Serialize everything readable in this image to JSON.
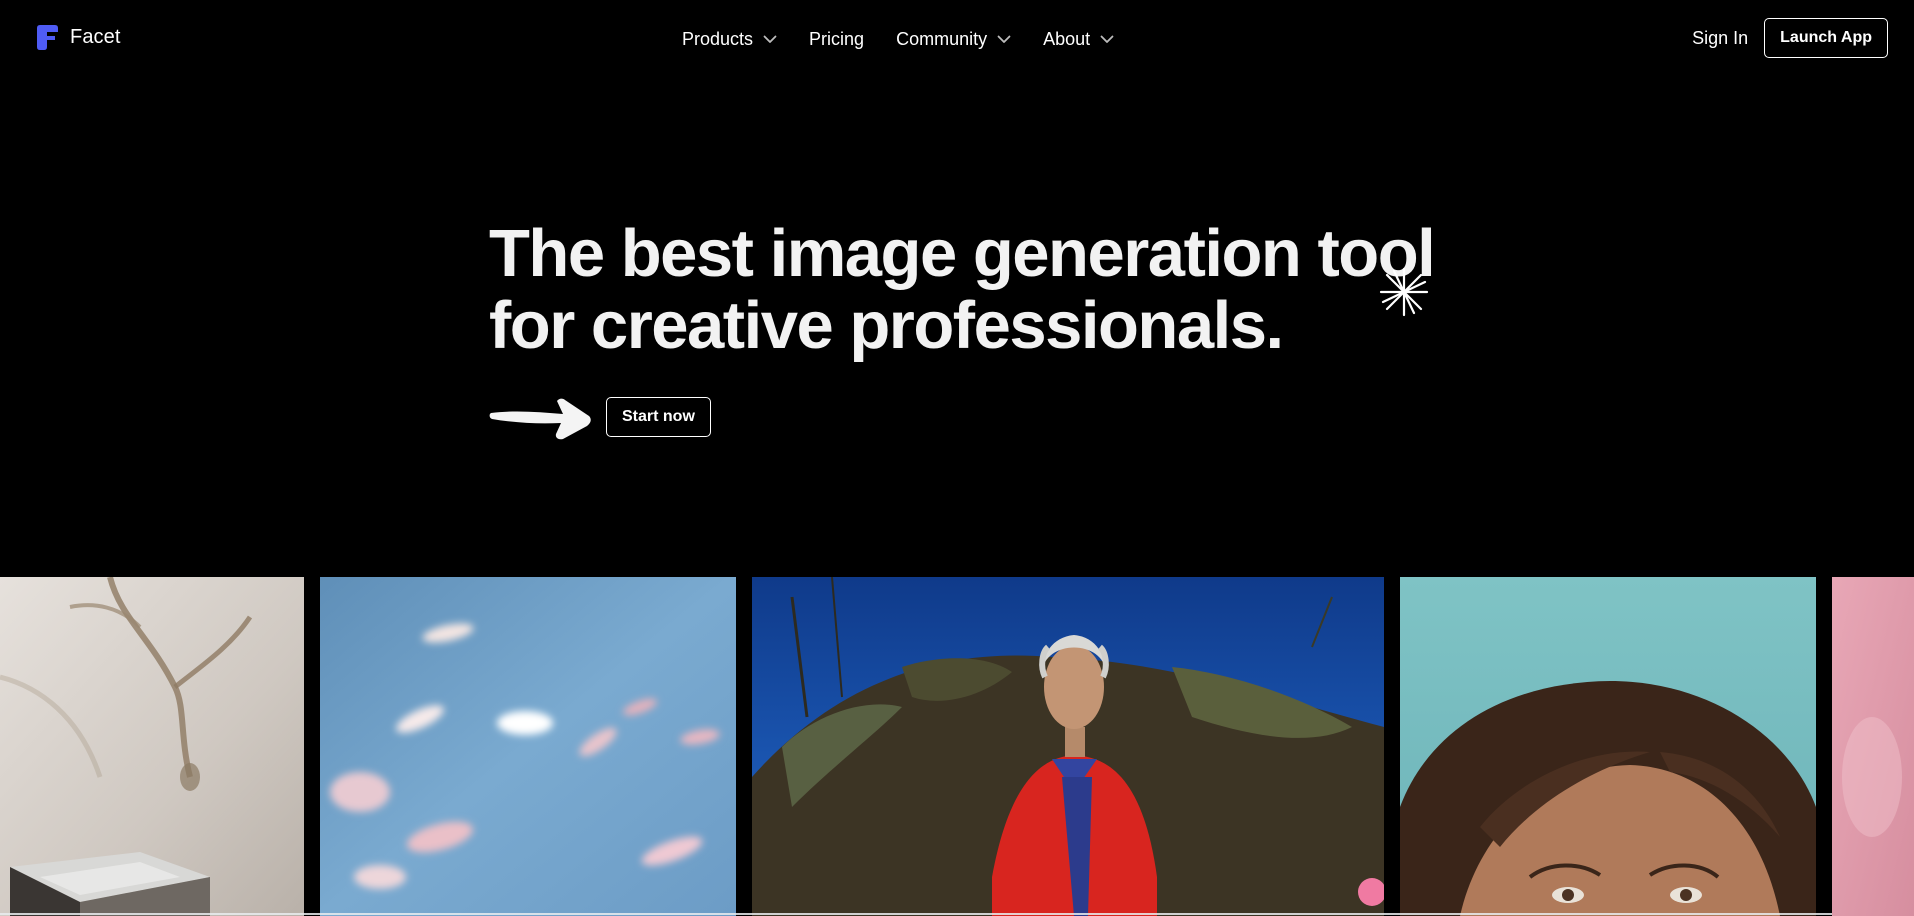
{
  "brand": {
    "name": "Facet",
    "accent_color": "#4f5cf5",
    "icon": "facet-logo-icon"
  },
  "nav": {
    "items": [
      {
        "label": "Products",
        "has_dropdown": true
      },
      {
        "label": "Pricing",
        "has_dropdown": false
      },
      {
        "label": "Community",
        "has_dropdown": true
      },
      {
        "label": "About",
        "has_dropdown": true
      }
    ]
  },
  "auth": {
    "sign_in": "Sign In",
    "launch_app": "Launch App"
  },
  "hero": {
    "title_line1": "The best image generation tool",
    "title_line2": "for creative professionals.",
    "cta": "Start now",
    "decor_icons": [
      "sparkle-icon",
      "hand-drawn-arrow-icon"
    ]
  },
  "gallery": {
    "images": [
      {
        "subject": "still life with metallic cube and branch shadows"
      },
      {
        "subject": "blurred koi fish in blue water"
      },
      {
        "subject": "man in red jacket in front of foliage"
      },
      {
        "subject": "close-up of woman's face against teal sky"
      },
      {
        "subject": "pink abstract"
      }
    ]
  }
}
